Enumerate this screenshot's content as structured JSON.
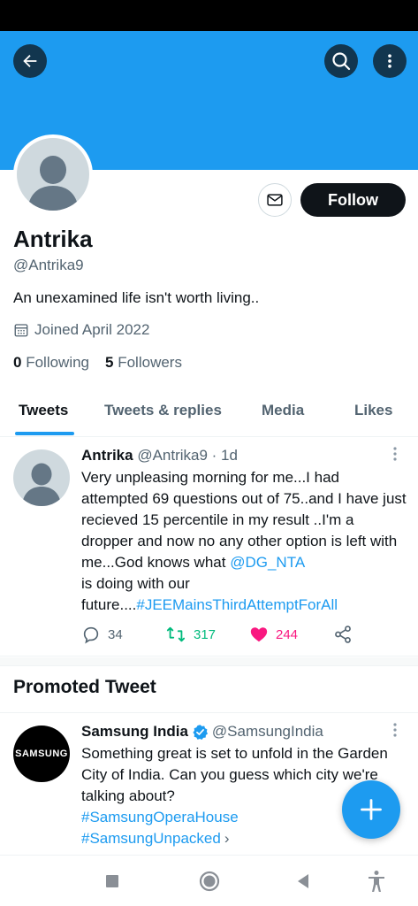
{
  "profile": {
    "name": "Antrika",
    "handle": "@Antrika9",
    "bio": "An unexamined life isn't worth living..",
    "joined": "Joined April 2022",
    "following_count": "0",
    "following_label": "Following",
    "followers_count": "5",
    "followers_label": "Followers",
    "follow_label": "Follow"
  },
  "tabs": [
    {
      "label": "Tweets",
      "active": true
    },
    {
      "label": "Tweets & replies",
      "active": false
    },
    {
      "label": "Media",
      "active": false
    },
    {
      "label": "Likes",
      "active": false
    }
  ],
  "tweet": {
    "author": "Antrika",
    "handle": "@Antrika9",
    "time": "· 1d",
    "text_part1": "Very unpleasing morning for me...I had attempted 69 questions out of 75..and I have just recieved 15 percentile in my result ..I'm a dropper and now no any other option is left with me...God knows what",
    "mention": "@DG_NTA",
    "text_part2": "is doing with our future....",
    "hashtag": "#JEEMainsThirdAttemptForAll",
    "replies": "34",
    "retweets": "317",
    "likes": "244"
  },
  "promoted": {
    "section_title": "Promoted Tweet",
    "logo_text": "SAMSUNG",
    "author": "Samsung India",
    "handle": "@SamsungIndia",
    "text": "Something great is set to unfold in the Garden City of India. Can you guess which city we're talking about?",
    "hashtag1": "#SamsungOperaHouse",
    "hashtag2": "#SamsungUnpacked"
  },
  "colors": {
    "accent": "#1d9bf0",
    "retweet": "#00ba7c",
    "like": "#f91880",
    "verified": "#1d9bf0"
  },
  "icons": [
    "back-arrow-icon",
    "search-icon",
    "more-vertical-icon",
    "mail-icon",
    "calendar-icon",
    "reply-icon",
    "retweet-icon",
    "heart-icon",
    "share-icon",
    "verified-icon",
    "plus-icon",
    "recents-icon",
    "home-icon",
    "back-triangle-icon",
    "accessibility-icon"
  ]
}
